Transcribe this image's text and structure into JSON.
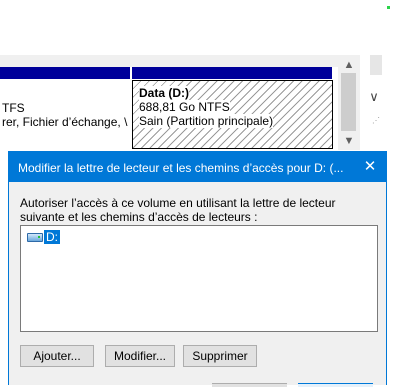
{
  "disk_map": {
    "left_partition": {
      "line1": "TFS",
      "line2": "rer, Fichier d’échange, \\"
    },
    "right_partition": {
      "name": "Data  (D:)",
      "size": "688,81 Go NTFS",
      "status": "Sain (Partition principale)"
    }
  },
  "dialog": {
    "title": "Modifier la lettre de lecteur et les chemins d’accès pour D: (...",
    "close_glyph": "✕",
    "description": "Autoriser l’accès à ce volume en utilisant la lettre de lecteur suivante et les chemins d’accès de lecteurs :",
    "list_items": [
      {
        "label": "D:",
        "icon": "drive-icon",
        "selected": true
      }
    ],
    "buttons": {
      "add": "Ajouter...",
      "modify": "Modifier...",
      "delete": "Supprimer"
    }
  },
  "scrollbar": {
    "up_glyph": "▲",
    "down_glyph": "▼"
  },
  "misc": {
    "chevron_glyph": "∨",
    "grip_glyph": "⋰"
  },
  "colors": {
    "accent": "#0078d7",
    "column_header": "#00009a",
    "dialog_bg": "#f0f0f0"
  }
}
